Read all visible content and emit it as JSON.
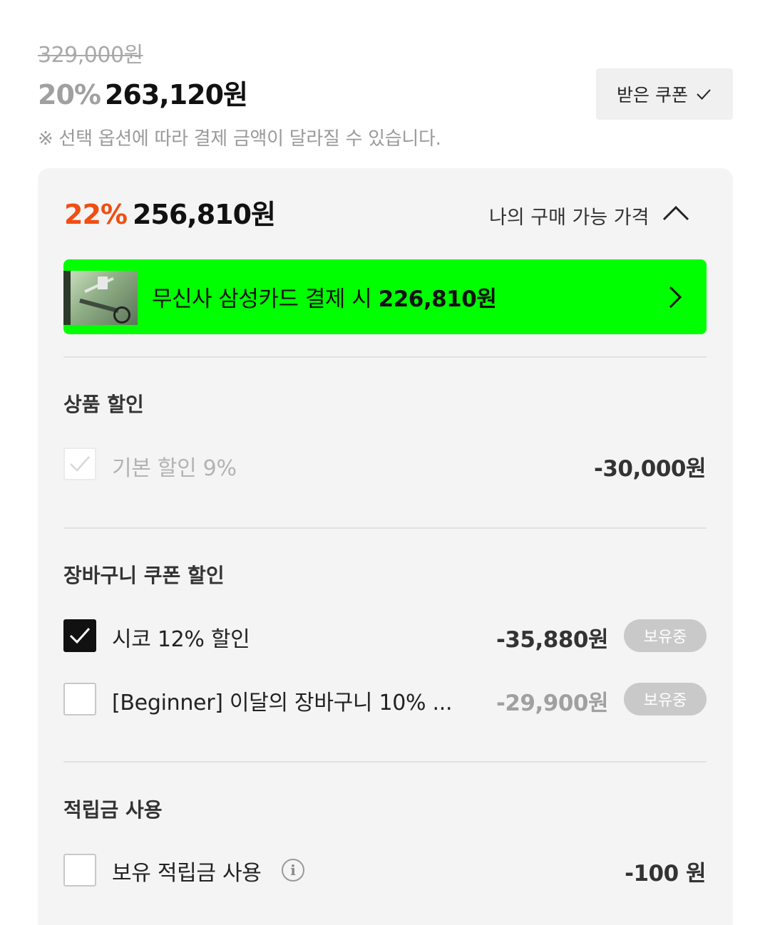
{
  "price": {
    "original": "329,000원",
    "sale_rate": "20%",
    "sale_price": "263,120원"
  },
  "coupon_button": {
    "label": "받은 쿠폰"
  },
  "notice": "※ 선택 옵션에 따라 결제 금액이 달라질 수 있습니다.",
  "my_price": {
    "rate": "22%",
    "price": "256,810원",
    "toggle_label": "나의 구매 가능 가격"
  },
  "card_banner": {
    "text_prefix": "무신사 삼성카드 결제 시 ",
    "amount": "226,810원"
  },
  "product_discount": {
    "title": "상품 할인",
    "items": [
      {
        "label": "기본 할인 9%",
        "amount": "-30,000원",
        "checked": true,
        "disabled": true
      }
    ]
  },
  "cart_coupon": {
    "title": "장바구니 쿠폰 할인",
    "items": [
      {
        "label": "시코 12% 할인",
        "amount": "-35,880원",
        "badge": "보유중",
        "checked": true
      },
      {
        "label": "[Beginner] 이달의 장바구니 10% ...",
        "amount": "-29,900원",
        "badge": "보유중",
        "checked": false
      }
    ]
  },
  "points": {
    "title": "적립금 사용",
    "items": [
      {
        "label": "보유 적립금 사용",
        "amount": "-100 원",
        "checked": false
      }
    ]
  },
  "icons": {
    "coupon_check": "check-icon",
    "toggle": "chevron-up-icon",
    "banner": "chevron-right-icon",
    "info": "info-icon"
  },
  "colors": {
    "best_rate": "#f04e12",
    "banner_bg": "#00ff00",
    "panel_bg": "#f4f4f4",
    "badge_bg": "#c9c9c9"
  }
}
